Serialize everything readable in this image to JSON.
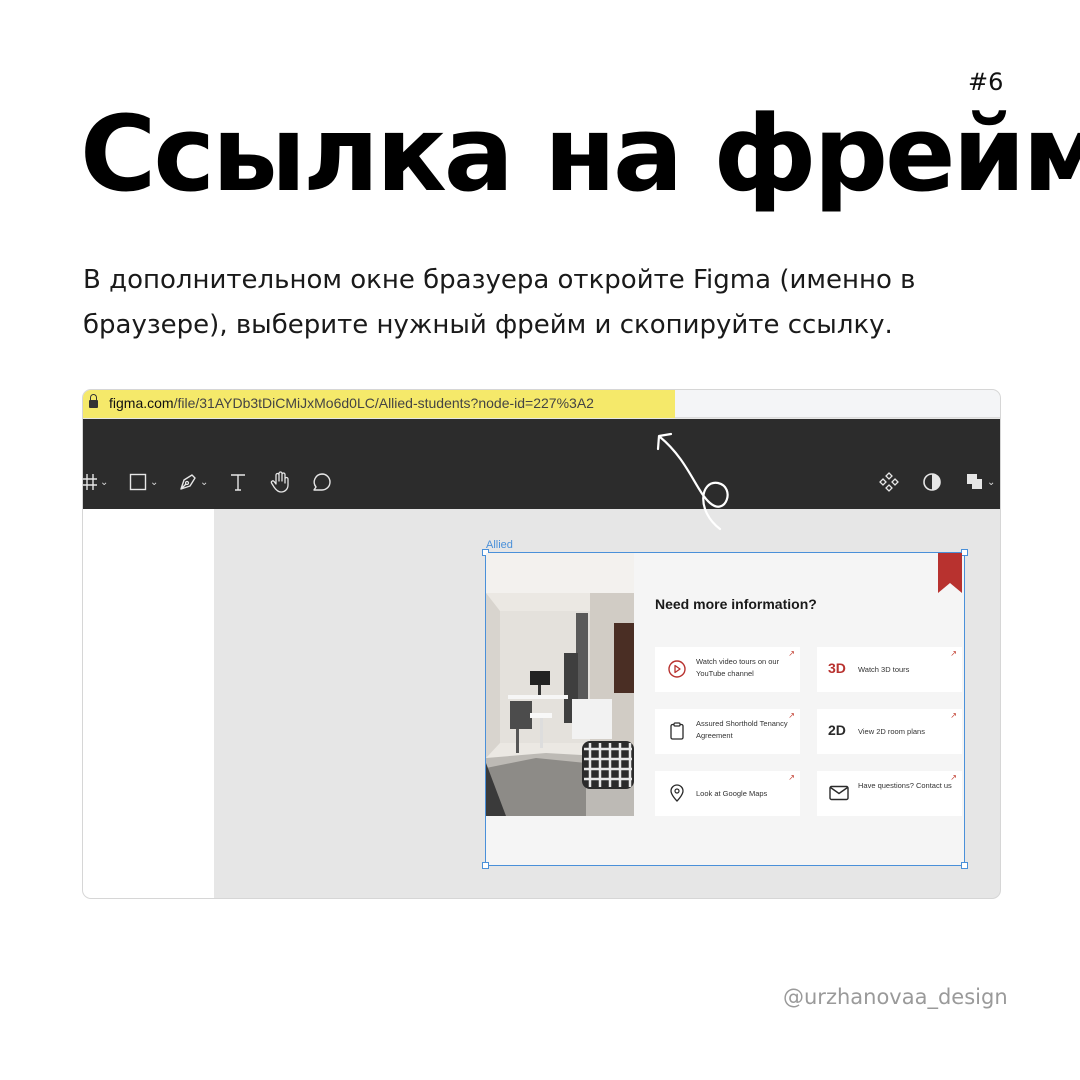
{
  "slide": {
    "number": "#6",
    "handle": "@urzhanovaa_design"
  },
  "title": "Ссылка на фрейм",
  "description": "В дополнительном окне бразуера откройте Figma (именно в браузере), выберите нужный фрейм и скопируйте ссылку.",
  "browser": {
    "url_host": "figma.com",
    "url_path": "/file/31AYDb3tDiCMiJxMo6d0LC/Allied-students?node-id=227%3A2",
    "highlight_color": "#f5e96a"
  },
  "figma": {
    "toolbar_left": [
      "frame-icon",
      "rectangle-icon",
      "pen-icon",
      "text-icon",
      "hand-icon",
      "comment-icon"
    ],
    "toolbar_right": [
      "component-icon",
      "contrast-icon",
      "boolean-icon"
    ],
    "frame_name": "Allied",
    "frame": {
      "heading": "Need more information?",
      "cards": [
        {
          "icon": "play-circle-icon",
          "label": "Watch video tours on our YouTube channel"
        },
        {
          "icon_text": "3D",
          "label": "Watch 3D tours"
        },
        {
          "icon": "clipboard-icon",
          "label": "Assured Shorthold Tenancy Agreement"
        },
        {
          "icon_text": "2D",
          "label": "View 2D room plans"
        },
        {
          "icon": "map-pin-icon",
          "label": "Look at Google Maps"
        },
        {
          "icon": "mail-icon",
          "label": "Have questions? Contact us"
        }
      ],
      "accent_color": "#b8322f"
    }
  }
}
